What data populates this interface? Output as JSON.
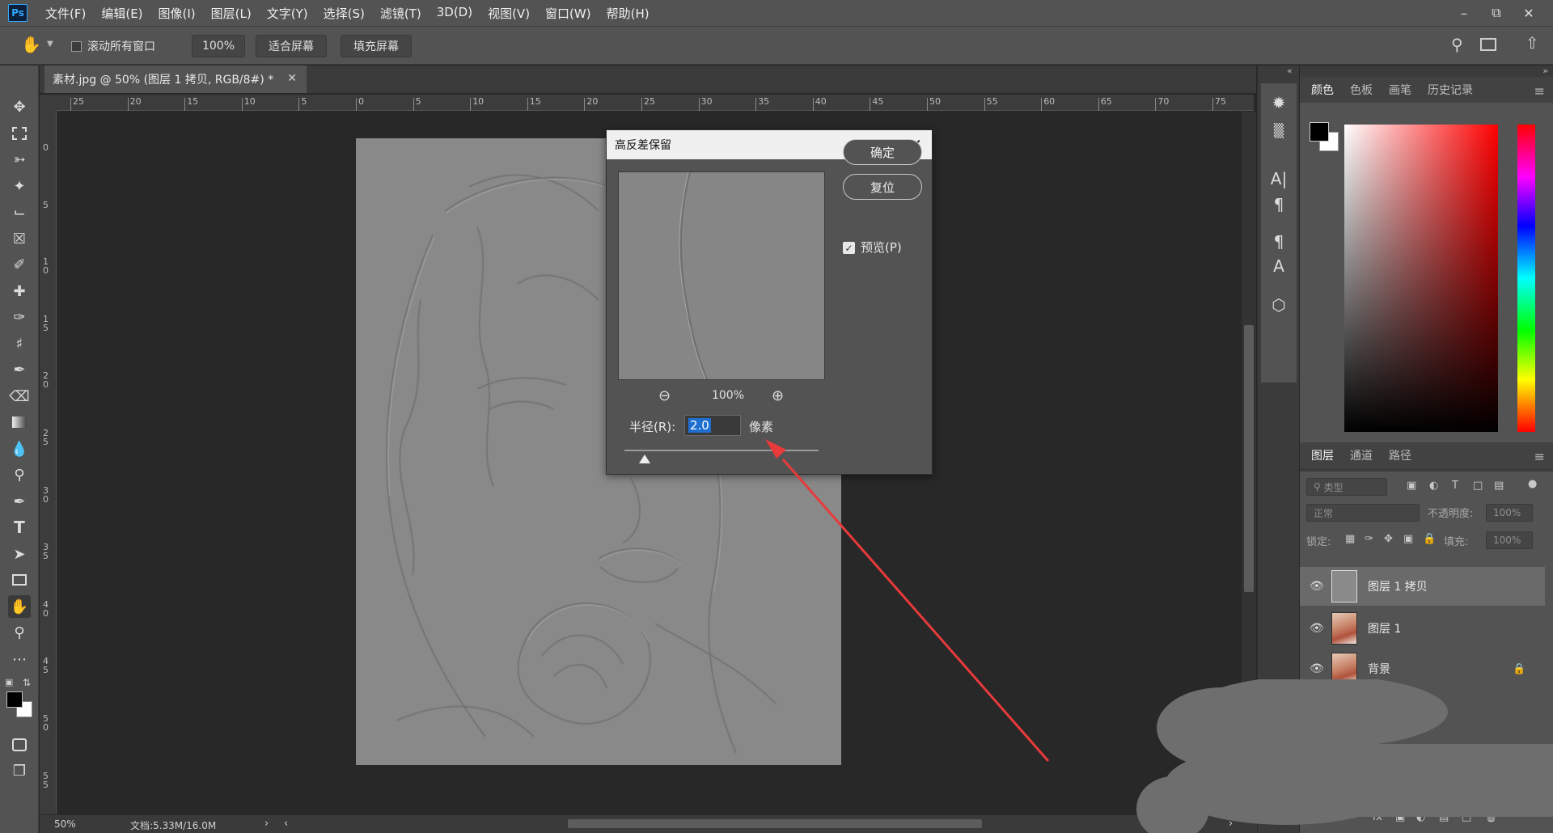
{
  "app": {
    "logo": "Ps",
    "menu": [
      "文件(F)",
      "编辑(E)",
      "图像(I)",
      "图层(L)",
      "文字(Y)",
      "选择(S)",
      "滤镜(T)",
      "3D(D)",
      "视图(V)",
      "窗口(W)",
      "帮助(H)"
    ]
  },
  "options_bar": {
    "scroll_all_label": "滚动所有窗口",
    "zoom_value": "100%",
    "fit_screen_label": "适合屏幕",
    "fill_screen_label": "填充屏幕"
  },
  "document": {
    "tab_title": "素材.jpg @ 50% (图层 1 拷贝, RGB/8#) *",
    "zoom": "50%",
    "doc_info": "文档:5.33M/16.0M"
  },
  "rulers": {
    "top": [
      "25",
      "20",
      "15",
      "10",
      "5",
      "0",
      "5",
      "10",
      "15",
      "20",
      "25",
      "30",
      "35",
      "40",
      "45",
      "50",
      "55",
      "60",
      "65",
      "70",
      "75"
    ],
    "left": [
      "0",
      "5",
      "1\n0",
      "1\n5",
      "2\n0",
      "2\n5",
      "3\n0",
      "3\n5",
      "4\n0",
      "4\n5",
      "5\n0",
      "5\n5"
    ]
  },
  "dialog": {
    "title": "高反差保留",
    "ok_label": "确定",
    "reset_label": "复位",
    "preview_label": "预览(P)",
    "preview_checked": true,
    "zoom_level": "100%",
    "radius_label": "半径(R):",
    "radius_value": "2.0",
    "radius_unit": "像素"
  },
  "color_panel": {
    "tabs": [
      "颜色",
      "色板",
      "画笔",
      "历史记录"
    ],
    "foreground": "#000000",
    "background": "#ffffff"
  },
  "layers_panel": {
    "tabs": [
      "图层",
      "通道",
      "路径"
    ],
    "filter_placeholder": "类型",
    "blend_mode": "正常",
    "opacity_label": "不透明度:",
    "opacity_value": "100%",
    "lock_label": "锁定:",
    "fill_label": "填充:",
    "fill_value": "100%",
    "layers": [
      {
        "name": "图层 1 拷贝",
        "selected": true
      },
      {
        "name": "图层 1",
        "selected": false
      },
      {
        "name": "背景",
        "selected": false,
        "locked": true
      }
    ]
  },
  "annotation": {
    "arrow_color": "#e83a3a"
  }
}
